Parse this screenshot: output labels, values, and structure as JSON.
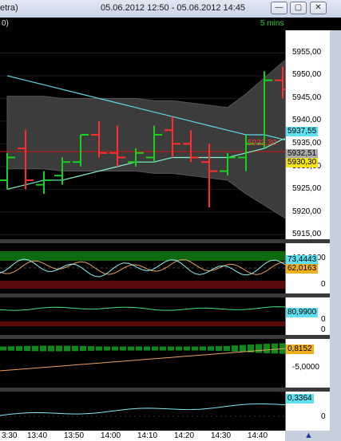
{
  "window": {
    "title_left": "etra)",
    "title_range": "05.06.2012 12:50 - 05.06.2012 14:45",
    "btn_min": "—",
    "btn_max": "▢",
    "btn_close": "✕"
  },
  "header": {
    "left": "0)",
    "interval": "5 mins"
  },
  "colors": {
    "up": "#19d11d",
    "down": "#ff2d2d",
    "band": "#3c3c3c",
    "ma_fast": "#7ff5c8",
    "ma_slow": "#60d6e8",
    "ref_line": "#d01010"
  },
  "price_axis": {
    "ticks": [
      "5955,00",
      "5950,00",
      "5945,00",
      "5940,00",
      "5935,00",
      "5930,00",
      "5925,00",
      "5920,00",
      "5915,00"
    ],
    "tag_ma": "5937,55",
    "tag_ref": "5933,30",
    "tag_gray": "5932,51",
    "tag_last": "5930,30"
  },
  "chart_data": {
    "type": "ohlc",
    "x": [
      "13:25",
      "13:30",
      "13:35",
      "13:40",
      "13:45",
      "13:50",
      "13:55",
      "14:00",
      "14:05",
      "14:10",
      "14:15",
      "14:20",
      "14:25",
      "14:30",
      "14:35",
      "14:40",
      "14:45"
    ],
    "open": [
      5927,
      5934,
      5926,
      5928,
      5931,
      5937,
      5933,
      5931,
      5932,
      5938,
      5935,
      5931,
      5929,
      5932,
      5935,
      5949,
      5947
    ],
    "high": [
      5933,
      5938,
      5929,
      5932,
      5937,
      5940,
      5939,
      5934,
      5939,
      5941,
      5938,
      5935,
      5933,
      5937,
      5951,
      5952,
      5948
    ],
    "low": [
      5925,
      5925,
      5924,
      5926,
      5930,
      5932,
      5930,
      5930,
      5931,
      5932,
      5931,
      5921,
      5928,
      5929,
      5934,
      5945,
      5928
    ],
    "close": [
      5932,
      5927,
      5927,
      5931,
      5937,
      5933,
      5932,
      5933,
      5937,
      5935,
      5932,
      5929,
      5932,
      5935,
      5949,
      5947,
      5930
    ],
    "ylim": [
      5914,
      5960
    ],
    "series": [
      {
        "values": [
          5950,
          5949,
          5948,
          5947,
          5946,
          5945,
          5944,
          5943,
          5942,
          5941,
          5940,
          5939,
          5938,
          5937,
          5937,
          5936,
          5935
        ]
      },
      {
        "values": [
          5925,
          5926,
          5927,
          5927,
          5928,
          5929,
          5930,
          5931,
          5931,
          5932,
          5932,
          5932,
          5932,
          5933,
          5934,
          5936,
          5937
        ]
      }
    ]
  },
  "indicators": [
    {
      "labels": [
        "100,0000",
        "73,4443",
        "62,0163",
        "0"
      ]
    },
    {
      "labels": [
        "80,9900",
        "0",
        "0"
      ]
    },
    {
      "labels": [
        "0,8152",
        "-5,0000"
      ]
    },
    {
      "labels": [
        "0,3364",
        "0"
      ]
    }
  ],
  "time_axis": {
    "labels": [
      "3:30",
      "13:40",
      "13:50",
      "14:00",
      "14:10",
      "14:20",
      "14:30",
      "14:40"
    ]
  }
}
